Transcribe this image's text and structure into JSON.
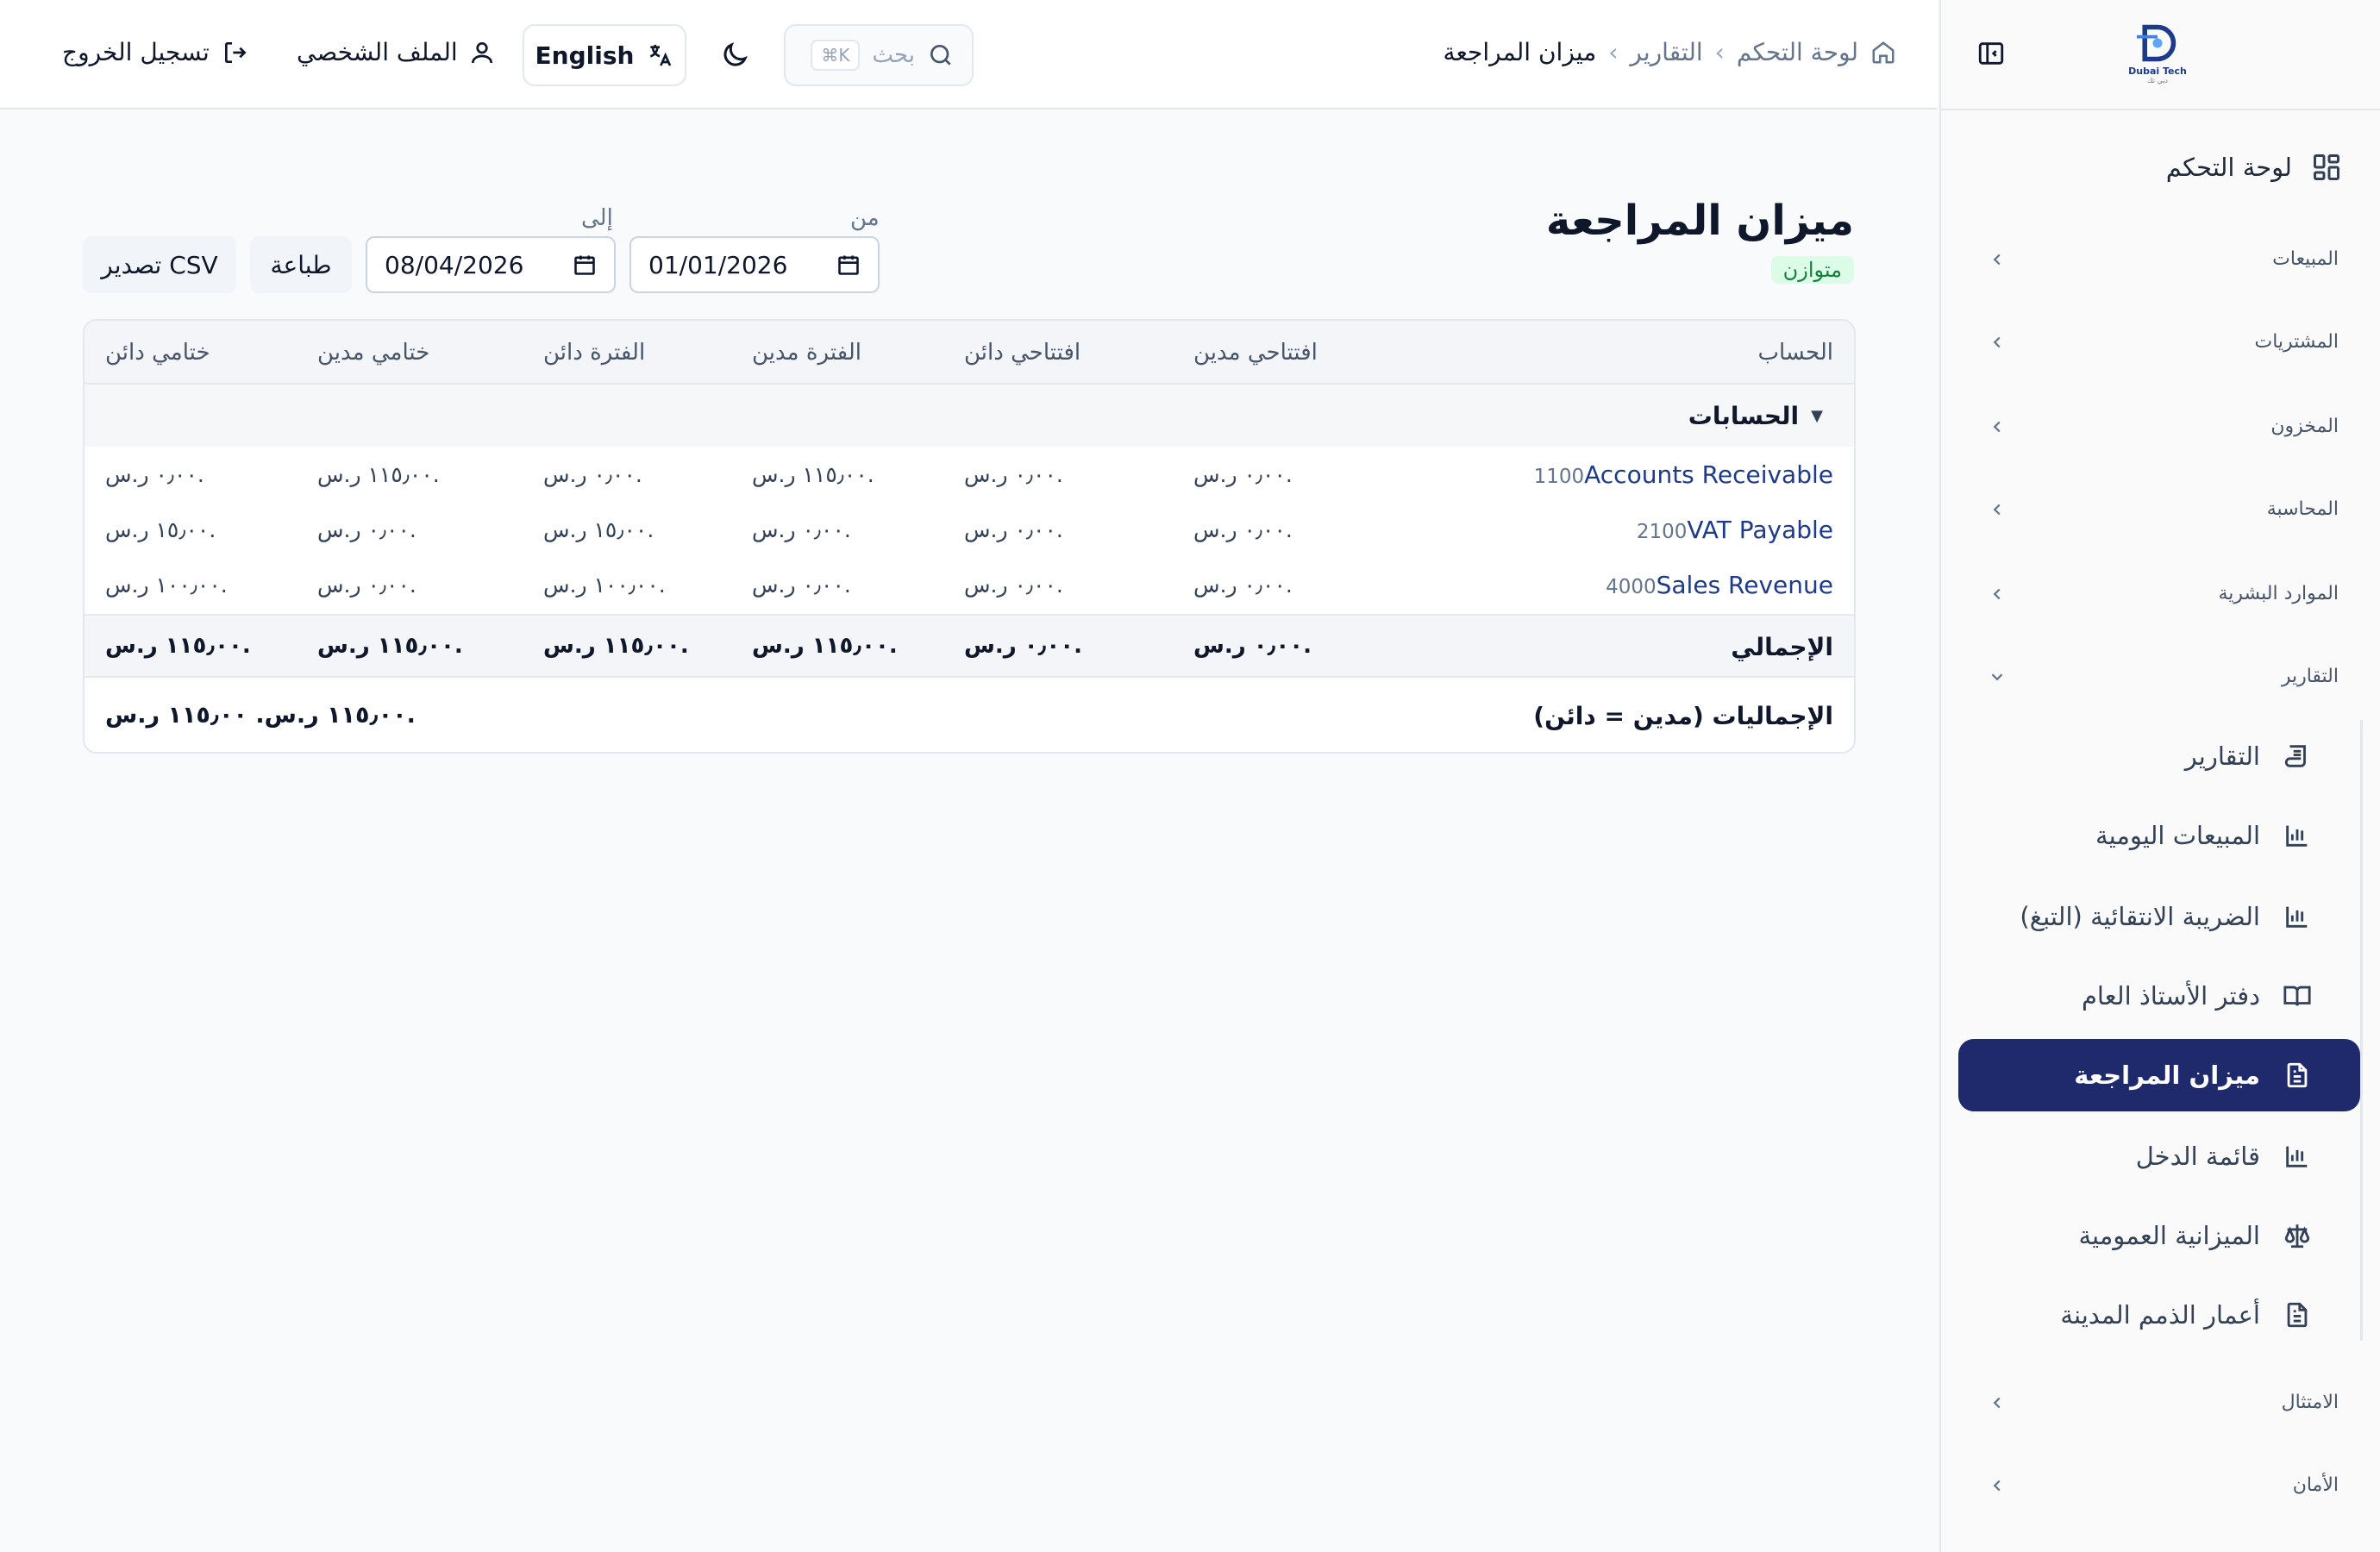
{
  "sidebar": {
    "logo": {
      "text": "Dubai Tech",
      "sub": "دبي تك"
    },
    "dashboard": "لوحة التحكم",
    "groups": {
      "sales": "المبيعات",
      "purchases": "المشتريات",
      "inventory": "المخزون",
      "accounting": "المحاسبة",
      "hr": "الموارد البشرية",
      "reports": "التقارير",
      "compliance": "الامتثال",
      "security": "الأمان"
    },
    "reports_items": [
      "التقارير",
      "المبيعات اليومية",
      "الضريبة الانتقائية (التبغ)",
      "دفتر الأستاذ العام",
      "ميزان المراجعة",
      "قائمة الدخل",
      "الميزانية العمومية",
      "أعمار الذمم المدينة"
    ]
  },
  "topbar": {
    "breadcrumb": [
      "لوحة التحكم",
      "التقارير",
      "ميزان المراجعة"
    ],
    "search_placeholder": "بحث",
    "search_kbd": "⌘K",
    "language": "English",
    "profile": "الملف الشخصي",
    "logout": "تسجيل الخروج"
  },
  "page": {
    "title": "ميزان المراجعة",
    "status_badge": "متوازن",
    "from_label": "من",
    "to_label": "إلى",
    "from_date": "01/01/2026",
    "to_date": "08/04/2026",
    "print": "طباعة",
    "export_csv": "تصدير CSV"
  },
  "table": {
    "headers": {
      "account": "الحساب",
      "opening_debit": "افتتاحي مدين",
      "opening_credit": "افتتاحي دائن",
      "period_debit": "الفترة مدين",
      "period_credit": "الفترة دائن",
      "closing_debit": "ختامي مدين",
      "closing_credit": "ختامي دائن"
    },
    "group_label": "الحسابات",
    "rows": [
      {
        "code": "1100",
        "name": "Accounts Receivable",
        "opening_debit": "٠٫٠٠ ر.س.",
        "opening_credit": "٠٫٠٠ ر.س.",
        "period_debit": "١١٥٫٠٠ ر.س.",
        "period_credit": "٠٫٠٠ ر.س.",
        "closing_debit": "١١٥٫٠٠ ر.س.",
        "closing_credit": "٠٫٠٠ ر.س."
      },
      {
        "code": "2100",
        "name": "VAT Payable",
        "opening_debit": "٠٫٠٠ ر.س.",
        "opening_credit": "٠٫٠٠ ر.س.",
        "period_debit": "٠٫٠٠ ر.س.",
        "period_credit": "١٥٫٠٠ ر.س.",
        "closing_debit": "٠٫٠٠ ر.س.",
        "closing_credit": "١٥٫٠٠ ر.س."
      },
      {
        "code": "4000",
        "name": "Sales Revenue",
        "opening_debit": "٠٫٠٠ ر.س.",
        "opening_credit": "٠٫٠٠ ر.س.",
        "period_debit": "٠٫٠٠ ر.س.",
        "period_credit": "١٠٠٫٠٠ ر.س.",
        "closing_debit": "٠٫٠٠ ر.س.",
        "closing_credit": "١٠٠٫٠٠ ر.س."
      }
    ],
    "total": {
      "label": "الإجمالي",
      "opening_debit": "٠٫٠٠ ر.س.",
      "opening_credit": "٠٫٠٠ ر.س.",
      "period_debit": "١١٥٫٠٠ ر.س.",
      "period_credit": "١١٥٫٠٠ ر.س.",
      "closing_debit": "١١٥٫٠٠ ر.س.",
      "closing_credit": "١١٥٫٠٠ ر.س."
    },
    "grand": {
      "label": "الإجماليات (مدين = دائن)",
      "value": "١١٥٫٠٠ ر.س. ١١٥٫٠٠ ر.س."
    }
  },
  "colors": {
    "accent": "#1e2a6b",
    "success_bg": "#dcfce7",
    "success_text": "#15803d"
  }
}
